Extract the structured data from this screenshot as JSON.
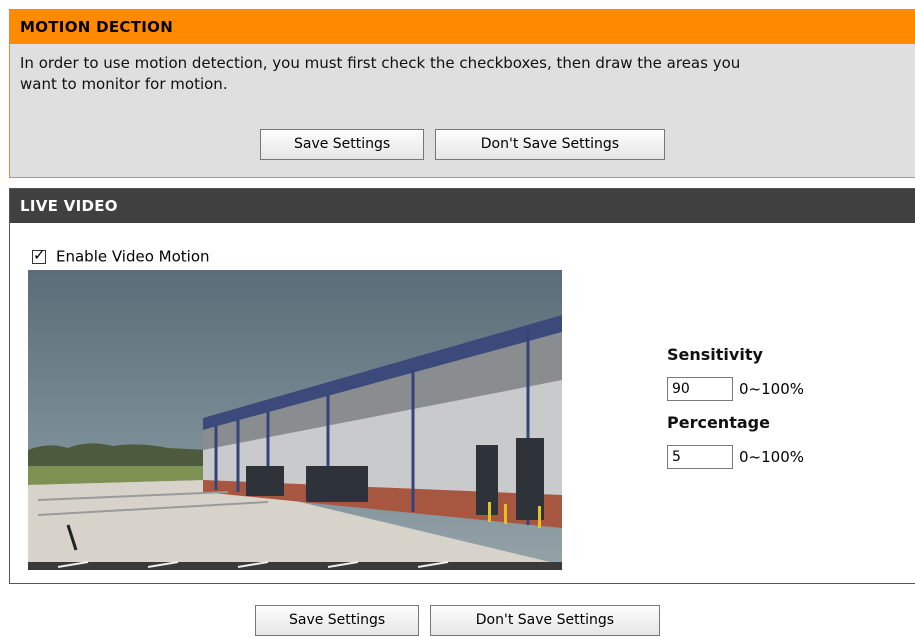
{
  "motion_panel": {
    "title": "MOTION DECTION",
    "description_line1": "In order to use motion detection, you must first check the checkboxes, then draw the areas you",
    "description_line2": "want to monitor for motion.",
    "save_label": "Save Settings",
    "dont_save_label": "Don't Save Settings"
  },
  "live_panel": {
    "title": "LIVE VIDEO",
    "enable_label": "Enable Video Motion",
    "enable_checked": true,
    "checkmark_glyph": "✓",
    "sensitivity_label": "Sensitivity",
    "sensitivity_value": "90",
    "sensitivity_range": "0~100%",
    "percentage_label": "Percentage",
    "percentage_value": "5",
    "percentage_range": "0~100%"
  },
  "bottom": {
    "save_label": "Save Settings",
    "dont_save_label": "Don't Save Settings"
  },
  "colors": {
    "motion_header": "#ff8a00",
    "live_header": "#404040",
    "panel_bg": "#dfdfdf"
  }
}
